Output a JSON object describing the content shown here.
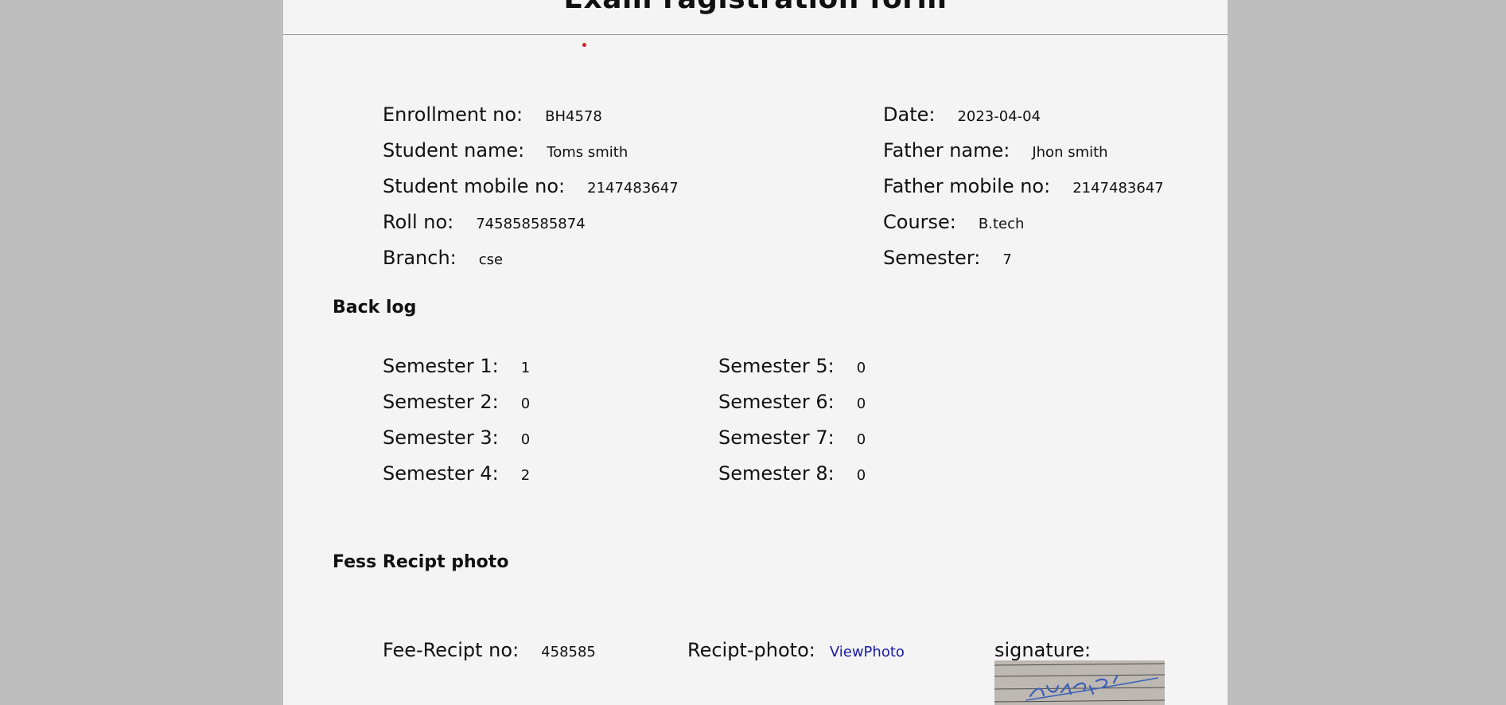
{
  "form": {
    "title": "Exam ragistration form"
  },
  "details": {
    "enrollment": {
      "label": "Enrollment no:",
      "value": "BH4578"
    },
    "date": {
      "label": "Date:",
      "value": "2023-04-04"
    },
    "student_name": {
      "label": "Student name:",
      "value": "Toms smith"
    },
    "father_name": {
      "label": "Father name:",
      "value": "Jhon smith"
    },
    "student_mobile": {
      "label": "Student mobile no:",
      "value": "2147483647"
    },
    "father_mobile": {
      "label": "Father mobile no:",
      "value": "2147483647"
    },
    "roll": {
      "label": "Roll no:",
      "value": "745858585874"
    },
    "course": {
      "label": "Course:",
      "value": "B.tech"
    },
    "branch": {
      "label": "Branch:",
      "value": "cse"
    },
    "semester": {
      "label": "Semester:",
      "value": "7"
    }
  },
  "backlog": {
    "heading": "Back log",
    "items": [
      {
        "label": "Semester 1:",
        "value": "1"
      },
      {
        "label": "Semester 2:",
        "value": "0"
      },
      {
        "label": "Semester 3:",
        "value": "0"
      },
      {
        "label": "Semester 4:",
        "value": "2"
      },
      {
        "label": "Semester 5:",
        "value": "0"
      },
      {
        "label": "Semester 6:",
        "value": "0"
      },
      {
        "label": "Semester 7:",
        "value": "0"
      },
      {
        "label": "Semester 8:",
        "value": "0"
      }
    ]
  },
  "fees": {
    "heading": "Fess Recipt photo",
    "receipt_no": {
      "label": "Fee-Recipt no:",
      "value": "458585"
    },
    "receipt_photo": {
      "label": "Recipt-photo:",
      "link": "ViewPhoto"
    },
    "signature": {
      "label": "signature:"
    }
  },
  "colors": {
    "outer_background": "#bebebe",
    "page_background": "#f4f4f4",
    "link": "#1a1aa6",
    "dot": "#d0202a"
  }
}
